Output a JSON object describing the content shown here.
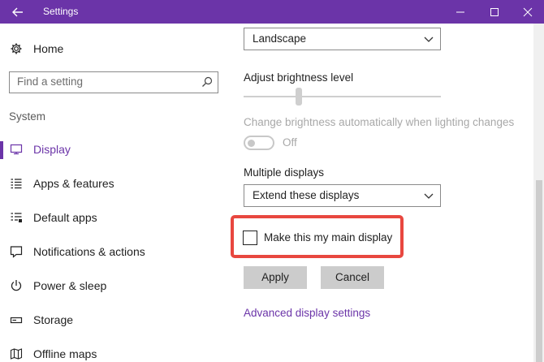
{
  "window": {
    "title": "Settings",
    "accent": "#6b34a8"
  },
  "sidebar": {
    "home_label": "Home",
    "search_placeholder": "Find a setting",
    "section_label": "System",
    "items": [
      {
        "label": "Display",
        "icon": "monitor-icon",
        "active": true
      },
      {
        "label": "Apps & features",
        "icon": "list-icon"
      },
      {
        "label": "Default apps",
        "icon": "default-apps-icon"
      },
      {
        "label": "Notifications & actions",
        "icon": "notification-icon"
      },
      {
        "label": "Power & sleep",
        "icon": "power-icon"
      },
      {
        "label": "Storage",
        "icon": "storage-icon"
      },
      {
        "label": "Offline maps",
        "icon": "map-icon"
      }
    ]
  },
  "content": {
    "orientation_value": "Landscape",
    "brightness_heading": "Adjust brightness level",
    "brightness_level": 0.28,
    "auto_brightness_heading": "Change brightness automatically when lighting changes",
    "auto_brightness_state": "Off",
    "multiple_displays_heading": "Multiple displays",
    "multiple_displays_value": "Extend these displays",
    "main_display_checkbox_label": "Make this my main display",
    "main_display_checked": false,
    "highlight_color": "#e8473f",
    "apply_label": "Apply",
    "cancel_label": "Cancel",
    "advanced_link": "Advanced display settings"
  }
}
